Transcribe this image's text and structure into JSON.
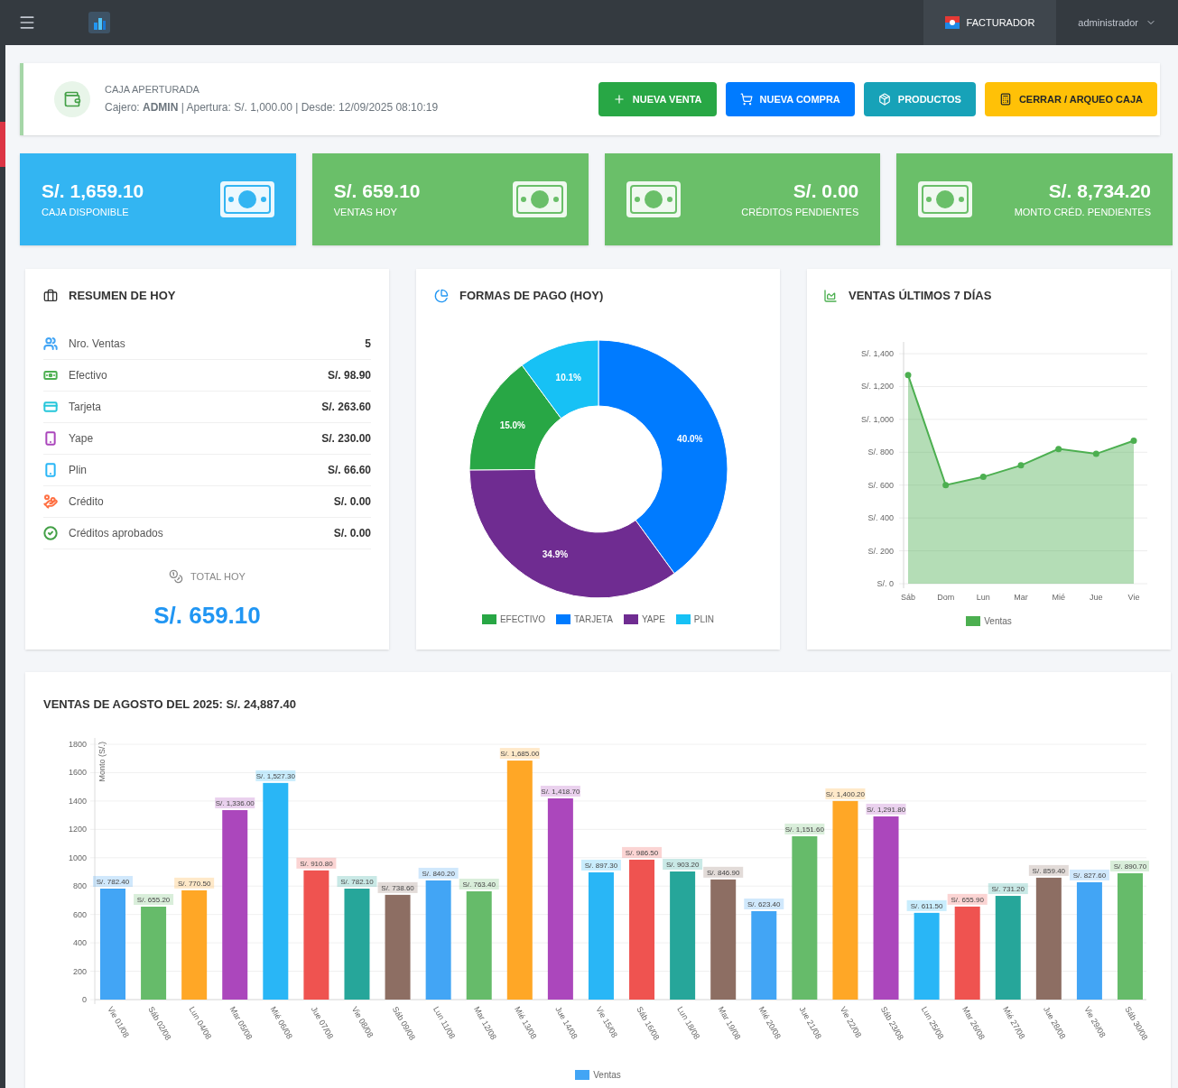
{
  "topbar": {
    "tabs": [
      {
        "label": "FACTURADOR",
        "selected": true
      }
    ],
    "user": "administrador"
  },
  "cash_status": {
    "title": "CAJA APERTURADA",
    "detail": "Cajero: **ADMIN** | Apertura: S/. 1,000.00 | Desde: 12/09/2025 08:10:19",
    "actions": [
      {
        "label": "NUEVA VENTA",
        "kind": "success"
      },
      {
        "label": "NUEVA COMPRA",
        "kind": "primary"
      },
      {
        "label": "PRODUCTOS",
        "kind": "info"
      },
      {
        "label": "CERRAR / ARQUEO CAJA",
        "kind": "warning"
      }
    ]
  },
  "stats": [
    {
      "value": "S/. 1,659.10",
      "label": "CAJA DISPONIBLE",
      "color": "#33b5f2",
      "kind": "icon-right"
    },
    {
      "value": "S/. 659.10",
      "label": "VENTAS HOY",
      "color": "#6abf69",
      "kind": "icon-right"
    },
    {
      "value": "S/. 0.00",
      "label": "CRÉDITOS PENDIENTES",
      "color": "#6abf69",
      "kind": "icon-left"
    },
    {
      "value": "S/. 8,734.20",
      "label": "MONTO CRÉD. PENDIENTES",
      "color": "#6abf69",
      "kind": "icon-left"
    }
  ],
  "summary": {
    "title": "RESUMEN DE HOY",
    "rows": [
      {
        "label": "Nro. Ventas",
        "value": "5",
        "color": "#42a5f5"
      },
      {
        "label": "Efectivo",
        "value": "S/. 98.90",
        "color": "#4caf50"
      },
      {
        "label": "Tarjeta",
        "value": "S/. 263.60",
        "color": "#26c6da"
      },
      {
        "label": "Yape",
        "value": "S/. 230.00",
        "color": "#ab47bc"
      },
      {
        "label": "Plin",
        "value": "S/. 66.60",
        "color": "#29b6f6"
      },
      {
        "label": "Crédito",
        "value": "S/. 0.00",
        "color": "#ff7043"
      },
      {
        "label": "Créditos aprobados",
        "value": "S/. 0.00",
        "color": "#43a047"
      }
    ],
    "total_label": "TOTAL HOY",
    "total": "S/. 659.10"
  },
  "payments": {
    "title": "FORMAS DE PAGO (HOY)",
    "chart_data": {
      "type": "donut",
      "categories": [
        "EFECTIVO",
        "TARJETA",
        "YAPE",
        "PLIN"
      ],
      "series": [
        {
          "colors": [
            "#28a745",
            "#007bff",
            "#6f2c91",
            "#17c1f5"
          ],
          "values": [
            15.0,
            40.0,
            34.9,
            10.1
          ]
        }
      ],
      "value_labels": [
        "15.0%",
        "40.0%",
        "34.9%",
        "10.1%"
      ]
    }
  },
  "weekly": {
    "title": "VENTAS ÚLTIMOS 7 DÍAS",
    "chart_data": {
      "type": "area",
      "x": [
        "Sáb",
        "Dom",
        "Lun",
        "Mar",
        "Mié",
        "Jue",
        "Vie"
      ],
      "series": [
        {
          "name": "Ventas",
          "color": "#4caf50",
          "values": [
            1270,
            600,
            650,
            720,
            820,
            790,
            870
          ]
        }
      ],
      "ylim": [
        0,
        1400
      ],
      "grid": true,
      "yticks": [
        {
          "value": 0,
          "label": "S/. 0"
        },
        {
          "value": 200,
          "label": "S/. 200"
        },
        {
          "value": 400,
          "label": "S/. 400"
        },
        {
          "value": 600,
          "label": "S/. 600"
        },
        {
          "value": 800,
          "label": "S/. 800"
        },
        {
          "value": 1000,
          "label": "S/. 1,000"
        },
        {
          "value": 1200,
          "label": "S/. 1,200"
        },
        {
          "value": 1400,
          "label": "S/. 1,400"
        }
      ]
    }
  },
  "monthly": {
    "title": "VENTAS DE AGOSTO DEL 2025: S/. 24,887.40",
    "chart_data": {
      "type": "bar",
      "ylabel": "Monto (S/.)",
      "grid": true,
      "categories": [
        "Vie 01/08",
        "Sáb 02/08",
        "Lun 04/08",
        "Mar 05/08",
        "Mié 06/08",
        "Jue 07/08",
        "Vie 08/08",
        "Sáb 09/08",
        "Lun 11/08",
        "Mar 12/08",
        "Mié 13/08",
        "Jue 14/08",
        "Vie 15/08",
        "Sáb 16/08",
        "Lun 18/08",
        "Mar 19/08",
        "Mié 20/08",
        "Jue 21/08",
        "Vie 22/08",
        "Sáb 23/08",
        "Lun 25/08",
        "Mar 26/08",
        "Mié 27/08",
        "Jue 28/08",
        "Vie 29/08",
        "Sáb 30/08"
      ],
      "series": [
        {
          "name": "Ventas",
          "color": "#42a5f5",
          "colors": [
            "#42a5f5",
            "#66bb6a",
            "#ffa726",
            "#ab47bc",
            "#29b6f6",
            "#ef5350",
            "#26a69a",
            "#8d6e63",
            "#42a5f5",
            "#66bb6a",
            "#ffa726",
            "#ab47bc",
            "#29b6f6",
            "#ef5350",
            "#26a69a",
            "#8d6e63",
            "#42a5f5",
            "#66bb6a",
            "#ffa726",
            "#ab47bc",
            "#29b6f6",
            "#ef5350",
            "#26a69a",
            "#8d6e63",
            "#42a5f5",
            "#66bb6a"
          ],
          "values": [
            782.4,
            655.2,
            770.5,
            1336.0,
            1527.3,
            910.8,
            782.1,
            738.6,
            840.2,
            763.4,
            1685.0,
            1418.7,
            897.3,
            986.5,
            903.2,
            846.9,
            623.4,
            1151.6,
            1400.2,
            1291.8,
            611.5,
            655.9,
            731.2,
            859.4,
            827.6,
            890.7
          ]
        }
      ],
      "value_labels": [
        "S/. 782.40",
        "S/. 655.20",
        "S/. 770.50",
        "S/. 1,336.00",
        "S/. 1,527.30",
        "S/. 910.80",
        "S/. 782.10",
        "S/. 738.60",
        "S/. 840.20",
        "S/. 763.40",
        "S/. 1,685.00",
        "S/. 1,418.70",
        "S/. 897.30",
        "S/. 986.50",
        "S/. 903.20",
        "S/. 846.90",
        "S/. 623.40",
        "S/. 1,151.60",
        "S/. 1,400.20",
        "S/. 1,291.80",
        "S/. 611.50",
        "S/. 655.90",
        "S/. 731.20",
        "S/. 859.40",
        "S/. 827.60",
        "S/. 890.70"
      ],
      "ylim": [
        0,
        1800
      ],
      "yticks": [
        0,
        200,
        400,
        600,
        800,
        1000,
        1200,
        1400,
        1600,
        1800
      ]
    }
  }
}
